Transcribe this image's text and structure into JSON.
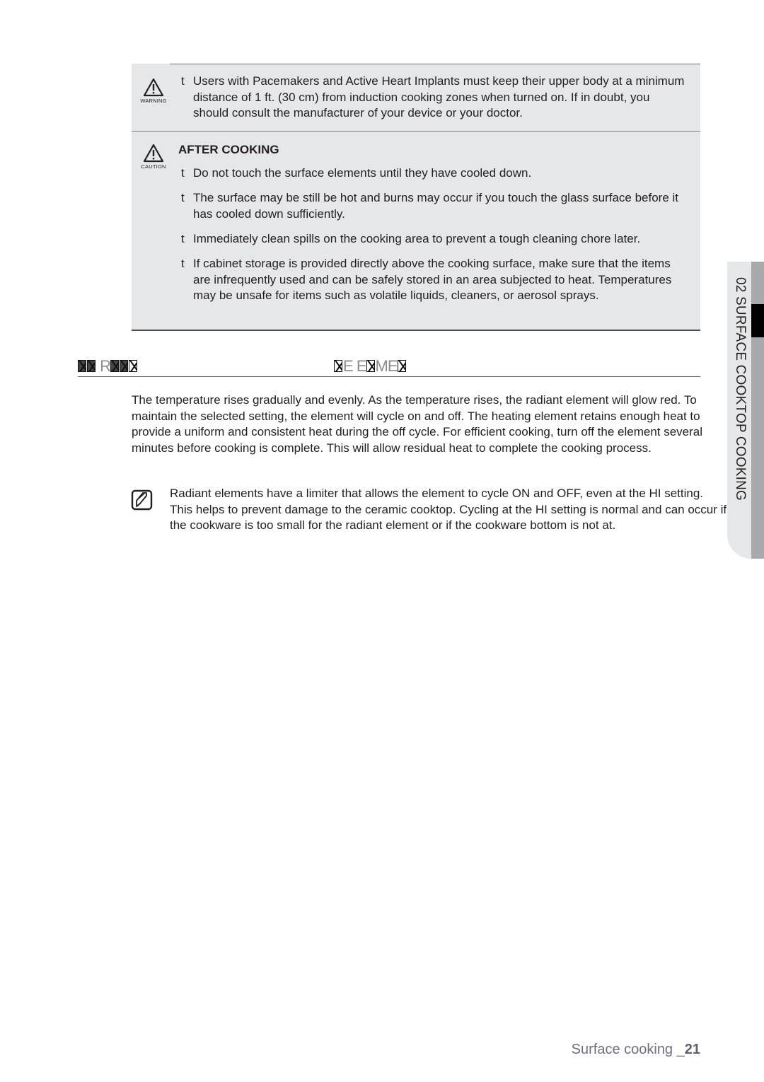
{
  "warning": {
    "icon": "warning-triangle-icon",
    "icon_label": "WARNING",
    "bullet_marker": "t",
    "items": [
      "Users with Pacemakers and Active Heart Implants must keep their upper body at a minimum distance of 1 ft. (30 cm) from induction cooking zones when turned on. If in doubt, you should consult the manufacturer of your device or your doctor."
    ]
  },
  "caution": {
    "icon": "caution-triangle-icon",
    "icon_label": "CAUTION",
    "title": "AFTER COOKING",
    "bullet_marker": "t",
    "items": [
      "Do not touch the surface elements until they have cooled down.",
      "The surface may be still be hot and burns may occur if you touch the glass surface before it has cooled down sufficiently.",
      "Immediately clean spills on the cooking area to prevent a tough cleaning chore later.",
      "If cabinet storage is provided directly above the cooking surface, make sure that the items are infrequently used and can be safely stored in an area subjected to heat. Temperatures may be unsafe for items such as volatile liquids, cleaners, or aerosol sprays."
    ]
  },
  "heading": {
    "left_visible_letters": "R",
    "right_visible_letters_1": "E",
    "right_visible_letters_2": "E",
    "right_visible_letters_3": "M",
    "right_visible_letters_4": "E",
    "note": "heading rendered with missing-glyph boxes"
  },
  "body": {
    "paragraph": "The temperature rises gradually and evenly. As the temperature rises, the radiant element will glow red. To maintain the selected setting, the element will cycle on and off. The heating element retains enough heat to provide a uniform and consistent heat during the off cycle. For efficient cooking, turn off the element several minutes before cooking is complete. This will allow residual heat to complete the cooking process.",
    "note_icon": "note-pencil-icon",
    "note": "Radiant elements have a limiter that allows the element to cycle ON and OFF, even at the HI setting. This helps to prevent damage to the ceramic cooktop. Cycling at the HI setting is normal and can occur if the cookware is too small for the radiant element or if the cookware bottom is not  at."
  },
  "side_tab": {
    "label": "02  SURFACE COOKTOP COOKING"
  },
  "footer": {
    "section": "Surface cooking _",
    "page_number": "21"
  }
}
